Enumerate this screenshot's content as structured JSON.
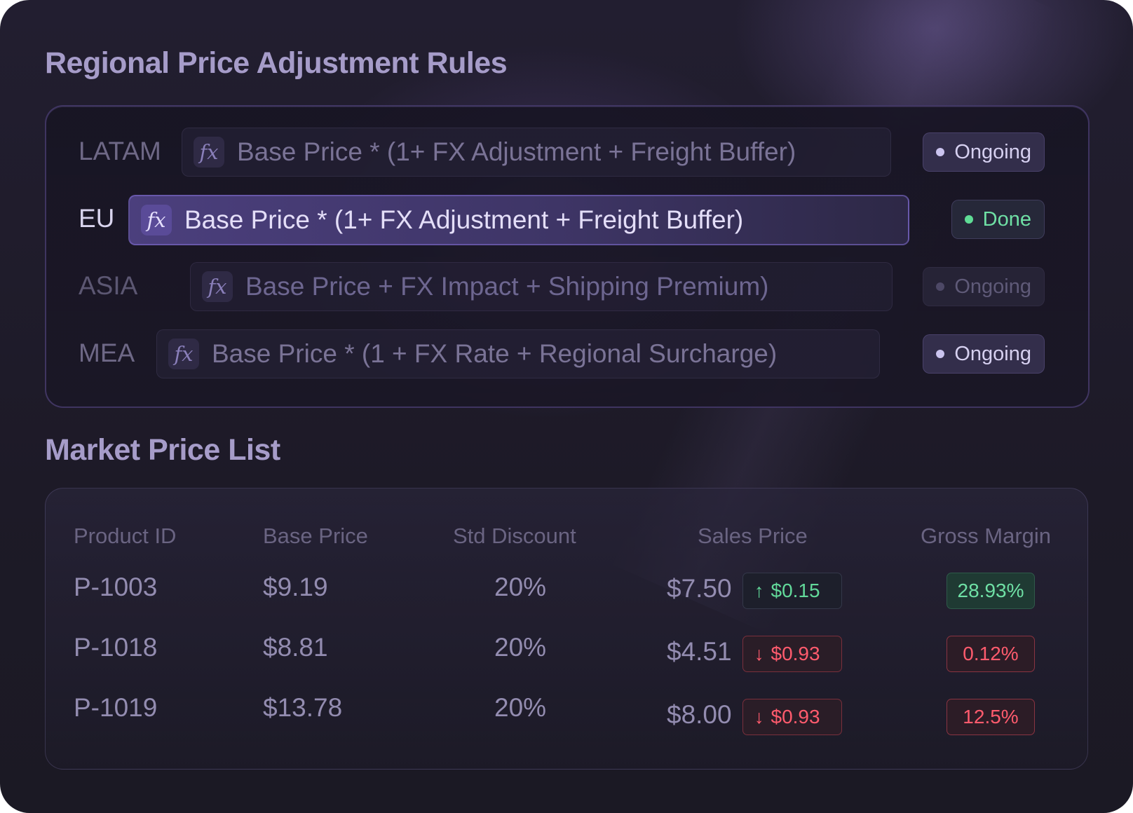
{
  "rules": {
    "title": "Regional Price Adjustment Rules",
    "rows": [
      {
        "region": "LATAM",
        "formula_icon": "fx",
        "formula": "Base Price * (1+ FX Adjustment + Freight Buffer)",
        "status": "Ongoing"
      },
      {
        "region": "EU",
        "formula_icon": "fx",
        "formula": "Base Price * (1+ FX Adjustment + Freight Buffer)",
        "status": "Done"
      },
      {
        "region": "ASIA",
        "formula_icon": "fx",
        "formula": "Base Price + FX Impact + Shipping Premium)",
        "status": "Ongoing"
      },
      {
        "region": "MEA",
        "formula_icon": "fx",
        "formula": "Base Price * (1 + FX Rate + Regional Surcharge)",
        "status": "Ongoing"
      }
    ]
  },
  "market": {
    "title": "Market Price List",
    "columns": [
      "Product ID",
      "Base Price",
      "Std Discount",
      "Sales Price",
      "Gross Margin"
    ],
    "rows": [
      {
        "product_id": "P-1003",
        "base_price": "$9.19",
        "std_discount": "20%",
        "sales_price": "$7.50",
        "delta_direction": "up",
        "delta": "$0.15",
        "gross_margin": "28.93%"
      },
      {
        "product_id": "P-1018",
        "base_price": "$8.81",
        "std_discount": "20%",
        "sales_price": "$4.51",
        "delta_direction": "down",
        "delta": "$0.93",
        "gross_margin": "0.12%"
      },
      {
        "product_id": "P-1019",
        "base_price": "$13.78",
        "std_discount": "20%",
        "sales_price": "$8.00",
        "delta_direction": "down",
        "delta": "$0.93",
        "gross_margin": "12.5%"
      }
    ]
  },
  "colors": {
    "background": "#201d2c",
    "accent": "#4b3f7d",
    "positive": "#6fe0a5",
    "negative": "#ff5b6d"
  }
}
